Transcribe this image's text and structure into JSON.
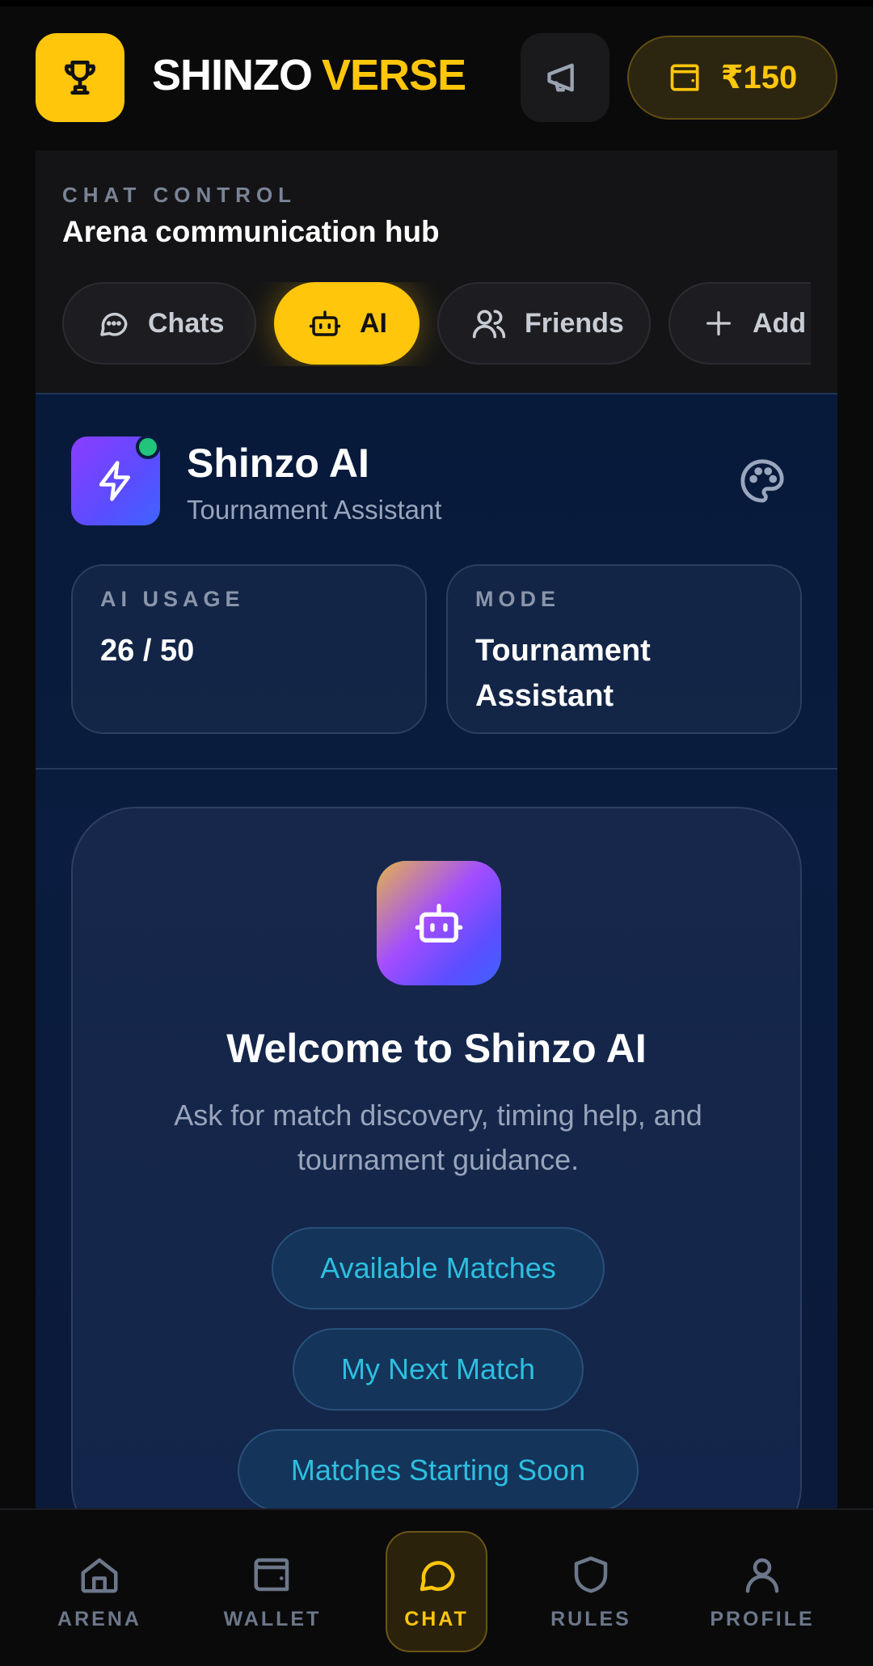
{
  "header": {
    "brand_word1": "SHINZO",
    "brand_word2": "VERSE",
    "logo_icon": "trophy-icon",
    "announce_icon": "megaphone-icon",
    "wallet_icon": "wallet-icon",
    "wallet_amount": "₹150"
  },
  "chat_control": {
    "kicker": "CHAT CONTROL",
    "title": "Arena communication hub",
    "tabs": [
      {
        "label": "Chats",
        "icon": "chat-bubble-icon",
        "active": false
      },
      {
        "label": "AI",
        "icon": "robot-icon",
        "active": true
      },
      {
        "label": "Friends",
        "icon": "users-icon",
        "active": false
      },
      {
        "label": "Add",
        "icon": "plus-icon",
        "active": false
      }
    ]
  },
  "ai": {
    "name": "Shinzo AI",
    "role": "Tournament Assistant",
    "avatar_icon": "lightning-icon",
    "theme_icon": "palette-icon",
    "usage_label": "AI USAGE",
    "usage_value": "26 / 50",
    "mode_label": "MODE",
    "mode_value": "Tournament Assistant",
    "welcome_title": "Welcome to Shinzo AI",
    "welcome_text": "Ask for match discovery, timing help, and tournament guidance.",
    "suggestions": [
      "Available Matches",
      "My Next Match",
      "Matches Starting Soon"
    ]
  },
  "bottom_nav": {
    "items": [
      {
        "label": "ARENA",
        "icon": "home-icon"
      },
      {
        "label": "WALLET",
        "icon": "wallet-icon"
      },
      {
        "label": "CHAT",
        "icon": "chat-bubble-icon",
        "active": true
      },
      {
        "label": "RULES",
        "icon": "shield-icon"
      },
      {
        "label": "PROFILE",
        "icon": "user-icon"
      }
    ]
  },
  "colors": {
    "accent": "#ffc60b",
    "background": "#0a0a0b",
    "ai_panel": "#0a1c3f",
    "chip_text": "#2dbfe0",
    "online": "#20c47a"
  }
}
